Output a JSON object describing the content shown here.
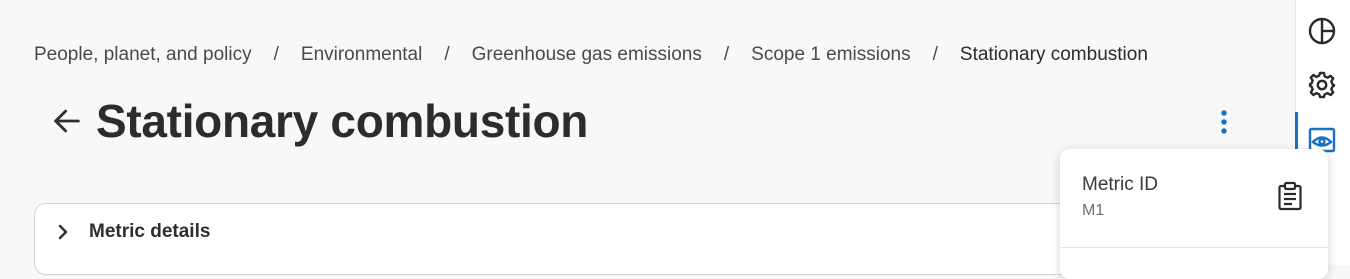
{
  "breadcrumb": {
    "items": [
      {
        "label": "People, planet, and policy"
      },
      {
        "label": "Environmental"
      },
      {
        "label": "Greenhouse gas emissions"
      },
      {
        "label": "Scope 1 emissions"
      },
      {
        "label": "Stationary combustion"
      }
    ],
    "separator": "/"
  },
  "header": {
    "title": "Stationary combustion",
    "back_icon": "arrow-left-icon",
    "menu_icon": "more-vertical-icon"
  },
  "details_panel": {
    "label": "Metric details",
    "icon": "chevron-right-icon"
  },
  "popover": {
    "label": "Metric ID",
    "value": "M1",
    "copy_icon": "clipboard-icon"
  },
  "side_rail": {
    "icons": [
      "pie-chart-icon",
      "gear-icon",
      "eye-icon"
    ],
    "active": "eye-icon"
  },
  "colors": {
    "accent": "#1670c5",
    "background": "#f8f8f8",
    "text": "#2e2e2e"
  }
}
